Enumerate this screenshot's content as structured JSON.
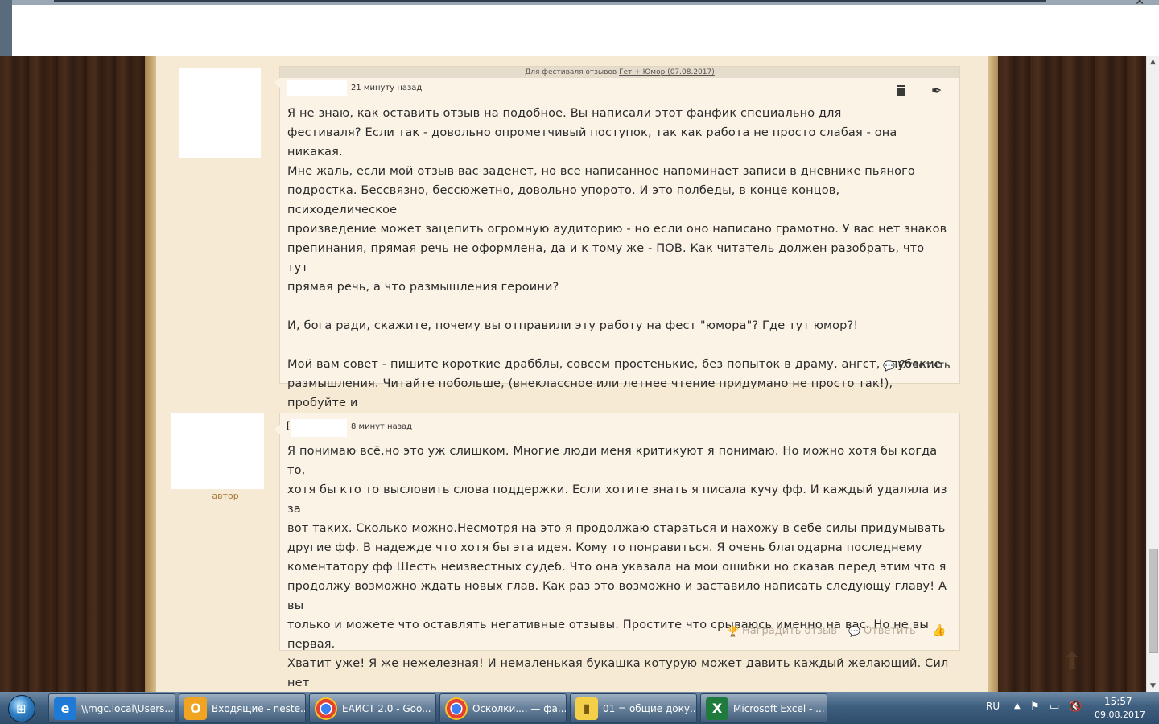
{
  "comments": [
    {
      "festival_prefix": "Для фестиваля отзывов",
      "festival_link": "Гет + Юмор (07.08.2017)",
      "time": "21 минуту назад",
      "text": "Я не знаю, как оставить отзыв на подобное. Вы написали этот фанфик специально для\nфестиваля? Если так - довольно опрометчивый поступок, так как работа не просто слабая - она никакая.\nМне жаль, если мой отзыв вас заденет, но все написанное напоминает записи в дневнике пьяного\nподростка. Бессвязно, бессюжетно, довольно упорото. И это полбеды, в конце концов, психоделическое\nпроизведение может зацепить огромную аудиторию - но если оно написано грамотно. У вас нет знаков\nпрепинания, прямая речь не оформлена, да и к тому же - ПОВ. Как читатель должен разобрать, что тут\nпрямая речь, а что размышления героини?\n\nИ, бога ради, скажите, почему вы отправили эту работу на фест \"юмора\"? Где тут юмор?!\n\nМой вам совет - пишите короткие драбблы, совсем простенькие, без попыток в драму, ангст, глубокие\nразмышления. Читайте побольше, (внеклассное или летнее чтение придумано не просто так!), пробуйте и\nсовершенствуйтесь. Удачи!",
      "reply_label": "Ответить"
    },
    {
      "author_tag": "автор",
      "name_prefix": "[",
      "time": "8 минут назад",
      "text": "Я понимаю всё,но это уж слишком. Многие люди меня критикуют я понимаю. Но можно хотя бы когда то,\nхотя бы кто то высловить слова поддержки. Если хотите знать я писала кучу фф. И каждый удаляла из за\nвот таких. Сколько можно.Несмотря на это я продолжаю стараться и нахожу в себе силы придумывать\nдругие фф. В надежде что хотя бы эта идея. Кому то понравиться. Я очень благодарна последнему\nкоментатору фф Шесть неизвестных судеб. Что она указала на мои ошибки но сказав перед этим что я\nпродолжу возможно ждать новых глав. Как раз это возможно и заставило написать следующу главу! А вы\nтолько и можете что оставлять негативные отзывы. Простите что срываюсь именно на вас. Но не вы первая.\nХватит уже! Я же нежелезная! И немаленькая букашка котурую может давить каждый желающий. Сил нет\nуже!",
      "reward_label": "Наградить отзыв",
      "reply_label": "Ответить"
    }
  ],
  "taskbar": {
    "items": [
      {
        "label": "\\\\mgc.local\\Users...",
        "icon": "ie-icon"
      },
      {
        "label": "Входящие - neste...",
        "icon": "outlook-icon"
      },
      {
        "label": "ЕАИСТ 2.0 - Goo...",
        "icon": "chrome-icon"
      },
      {
        "label": "Осколки.... — фа...",
        "icon": "chrome-icon"
      },
      {
        "label": "01 = общие доку...",
        "icon": "folder-icon"
      },
      {
        "label": "Microsoft Excel - ...",
        "icon": "excel-icon"
      }
    ],
    "lang": "RU",
    "time": "15:57",
    "date": "09.08.2017"
  }
}
